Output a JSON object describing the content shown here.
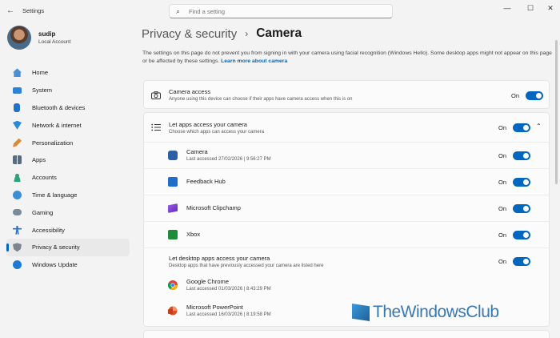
{
  "titlebar": {
    "back_glyph": "←",
    "app_title": "Settings",
    "search_placeholder": "Find a setting",
    "minimize_glyph": "—",
    "maximize_glyph": "☐",
    "close_glyph": "✕"
  },
  "profile": {
    "name": "sudip",
    "account": "Local Account"
  },
  "nav": [
    {
      "label": "Home",
      "icon": "home-icon",
      "color": "#4a8fd6"
    },
    {
      "label": "System",
      "icon": "system-icon",
      "color": "#2e82d6"
    },
    {
      "label": "Bluetooth & devices",
      "icon": "bluetooth-icon",
      "color": "#1e73c8"
    },
    {
      "label": "Network & internet",
      "icon": "wifi-icon",
      "color": "#2a8ad8"
    },
    {
      "label": "Personalization",
      "icon": "brush-icon",
      "color": "#d88a36"
    },
    {
      "label": "Apps",
      "icon": "apps-icon",
      "color": "#5a6b80"
    },
    {
      "label": "Accounts",
      "icon": "accounts-icon",
      "color": "#2aa57a"
    },
    {
      "label": "Time & language",
      "icon": "globe-icon",
      "color": "#3a8fd4"
    },
    {
      "label": "Gaming",
      "icon": "gamepad-icon",
      "color": "#7a8a9a"
    },
    {
      "label": "Accessibility",
      "icon": "accessibility-icon",
      "color": "#2a6fc4"
    },
    {
      "label": "Privacy & security",
      "icon": "shield-icon",
      "color": "#7d8590"
    },
    {
      "label": "Windows Update",
      "icon": "update-icon",
      "color": "#1e7ad0"
    }
  ],
  "active_nav": "Privacy & security",
  "breadcrumb": {
    "parent": "Privacy & security",
    "separator": "›",
    "current": "Camera"
  },
  "description": {
    "text": "The settings on this page do not prevent you from signing in with your camera using facial recognition (Windows Hello). Some desktop apps might not appear on this page or be affected by these settings.",
    "link": "Learn more about camera"
  },
  "camera_access": {
    "title": "Camera access",
    "subtitle": "Anyone using this device can choose if their apps have camera access when this is on",
    "state": "On"
  },
  "apps_access": {
    "title": "Let apps access your camera",
    "subtitle": "Choose which apps can access your camera",
    "state": "On",
    "chevron": "⌃"
  },
  "apps": [
    {
      "name": "Camera",
      "sub": "Last accessed 27/02/2026  |  9:56:27 PM",
      "state": "On",
      "color": "#2c5fa8"
    },
    {
      "name": "Feedback Hub",
      "sub": "",
      "state": "On",
      "color": "#1e6fc8"
    },
    {
      "name": "Microsoft Clipchamp",
      "sub": "",
      "state": "On",
      "color": "#7b3fd6"
    },
    {
      "name": "Xbox",
      "sub": "",
      "state": "On",
      "color": "#1f8a3a"
    }
  ],
  "desktop_apps": {
    "title": "Let desktop apps access your camera",
    "subtitle": "Desktop apps that have previously accessed your camera are listed here",
    "state": "On",
    "items": [
      {
        "name": "Google Chrome",
        "sub": "Last accessed 01/03/2026  |  8:43:29 PM"
      },
      {
        "name": "Microsoft PowerPoint",
        "sub": "Last accessed 16/03/2026  |  8:19:58 PM"
      }
    ]
  },
  "watermark": "TheWindowsClub"
}
